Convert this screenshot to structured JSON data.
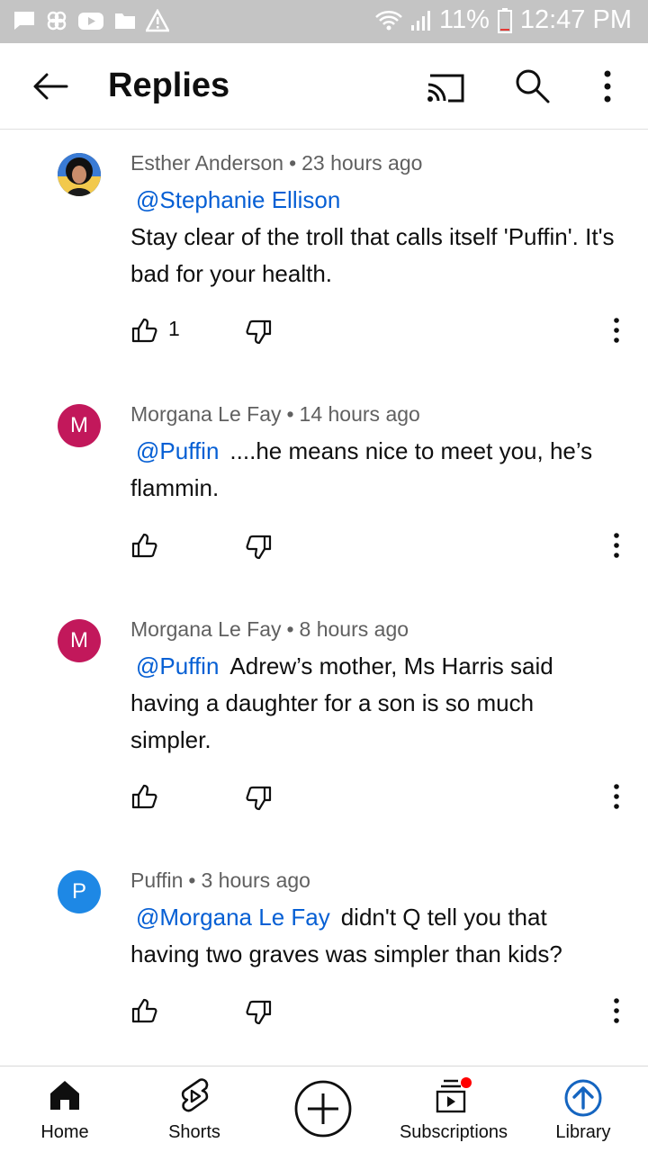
{
  "status_bar": {
    "battery": "11%",
    "time": "12:47 PM",
    "icons": [
      "message-icon",
      "pinwheel-icon",
      "youtube-icon",
      "folder-icon",
      "warning-icon",
      "wifi-icon",
      "signal-icon",
      "battery-icon"
    ]
  },
  "header": {
    "title": "Replies",
    "icons": [
      "back-arrow-icon",
      "cast-icon",
      "search-icon",
      "more-vert-icon"
    ]
  },
  "colors": {
    "mention": "#065fd4",
    "avatar_m": "#c2185b",
    "avatar_p": "#1e88e5",
    "library_accent": "#1565c0",
    "notification_dot": "#ff0000"
  },
  "comments": [
    {
      "author": "Esther Anderson",
      "separator": "•",
      "time": "23 hours ago",
      "avatar": "photo",
      "mention": "@Stephanie Ellison",
      "text": "Stay clear of the troll that calls itself 'Puffin'. It's bad for your health.",
      "likes": "1"
    },
    {
      "author": "Morgana Le Fay",
      "separator": "•",
      "time": "14 hours ago",
      "avatar": "M",
      "mention": "@Puffin",
      "text": "....he means nice to meet you, he’s flammin.",
      "likes": ""
    },
    {
      "author": "Morgana Le Fay",
      "separator": "•",
      "time": "8 hours ago",
      "avatar": "M",
      "mention": "@Puffin",
      "text": "Adrew’s mother, Ms Harris said having a daughter for a son is so much simpler.",
      "likes": ""
    },
    {
      "author": "Puffin",
      "separator": "•",
      "time": "3 hours ago",
      "avatar": "P",
      "mention": "@Morgana Le Fay",
      "text": "didn't Q tell you that having two graves was simpler than kids?",
      "likes": ""
    }
  ],
  "bottom_nav": {
    "items": [
      {
        "label": "Home",
        "icon": "home-icon"
      },
      {
        "label": "Shorts",
        "icon": "shorts-icon"
      },
      {
        "label": "",
        "icon": "create-icon"
      },
      {
        "label": "Subscriptions",
        "icon": "subscriptions-icon"
      },
      {
        "label": "Library",
        "icon": "library-icon"
      }
    ]
  }
}
